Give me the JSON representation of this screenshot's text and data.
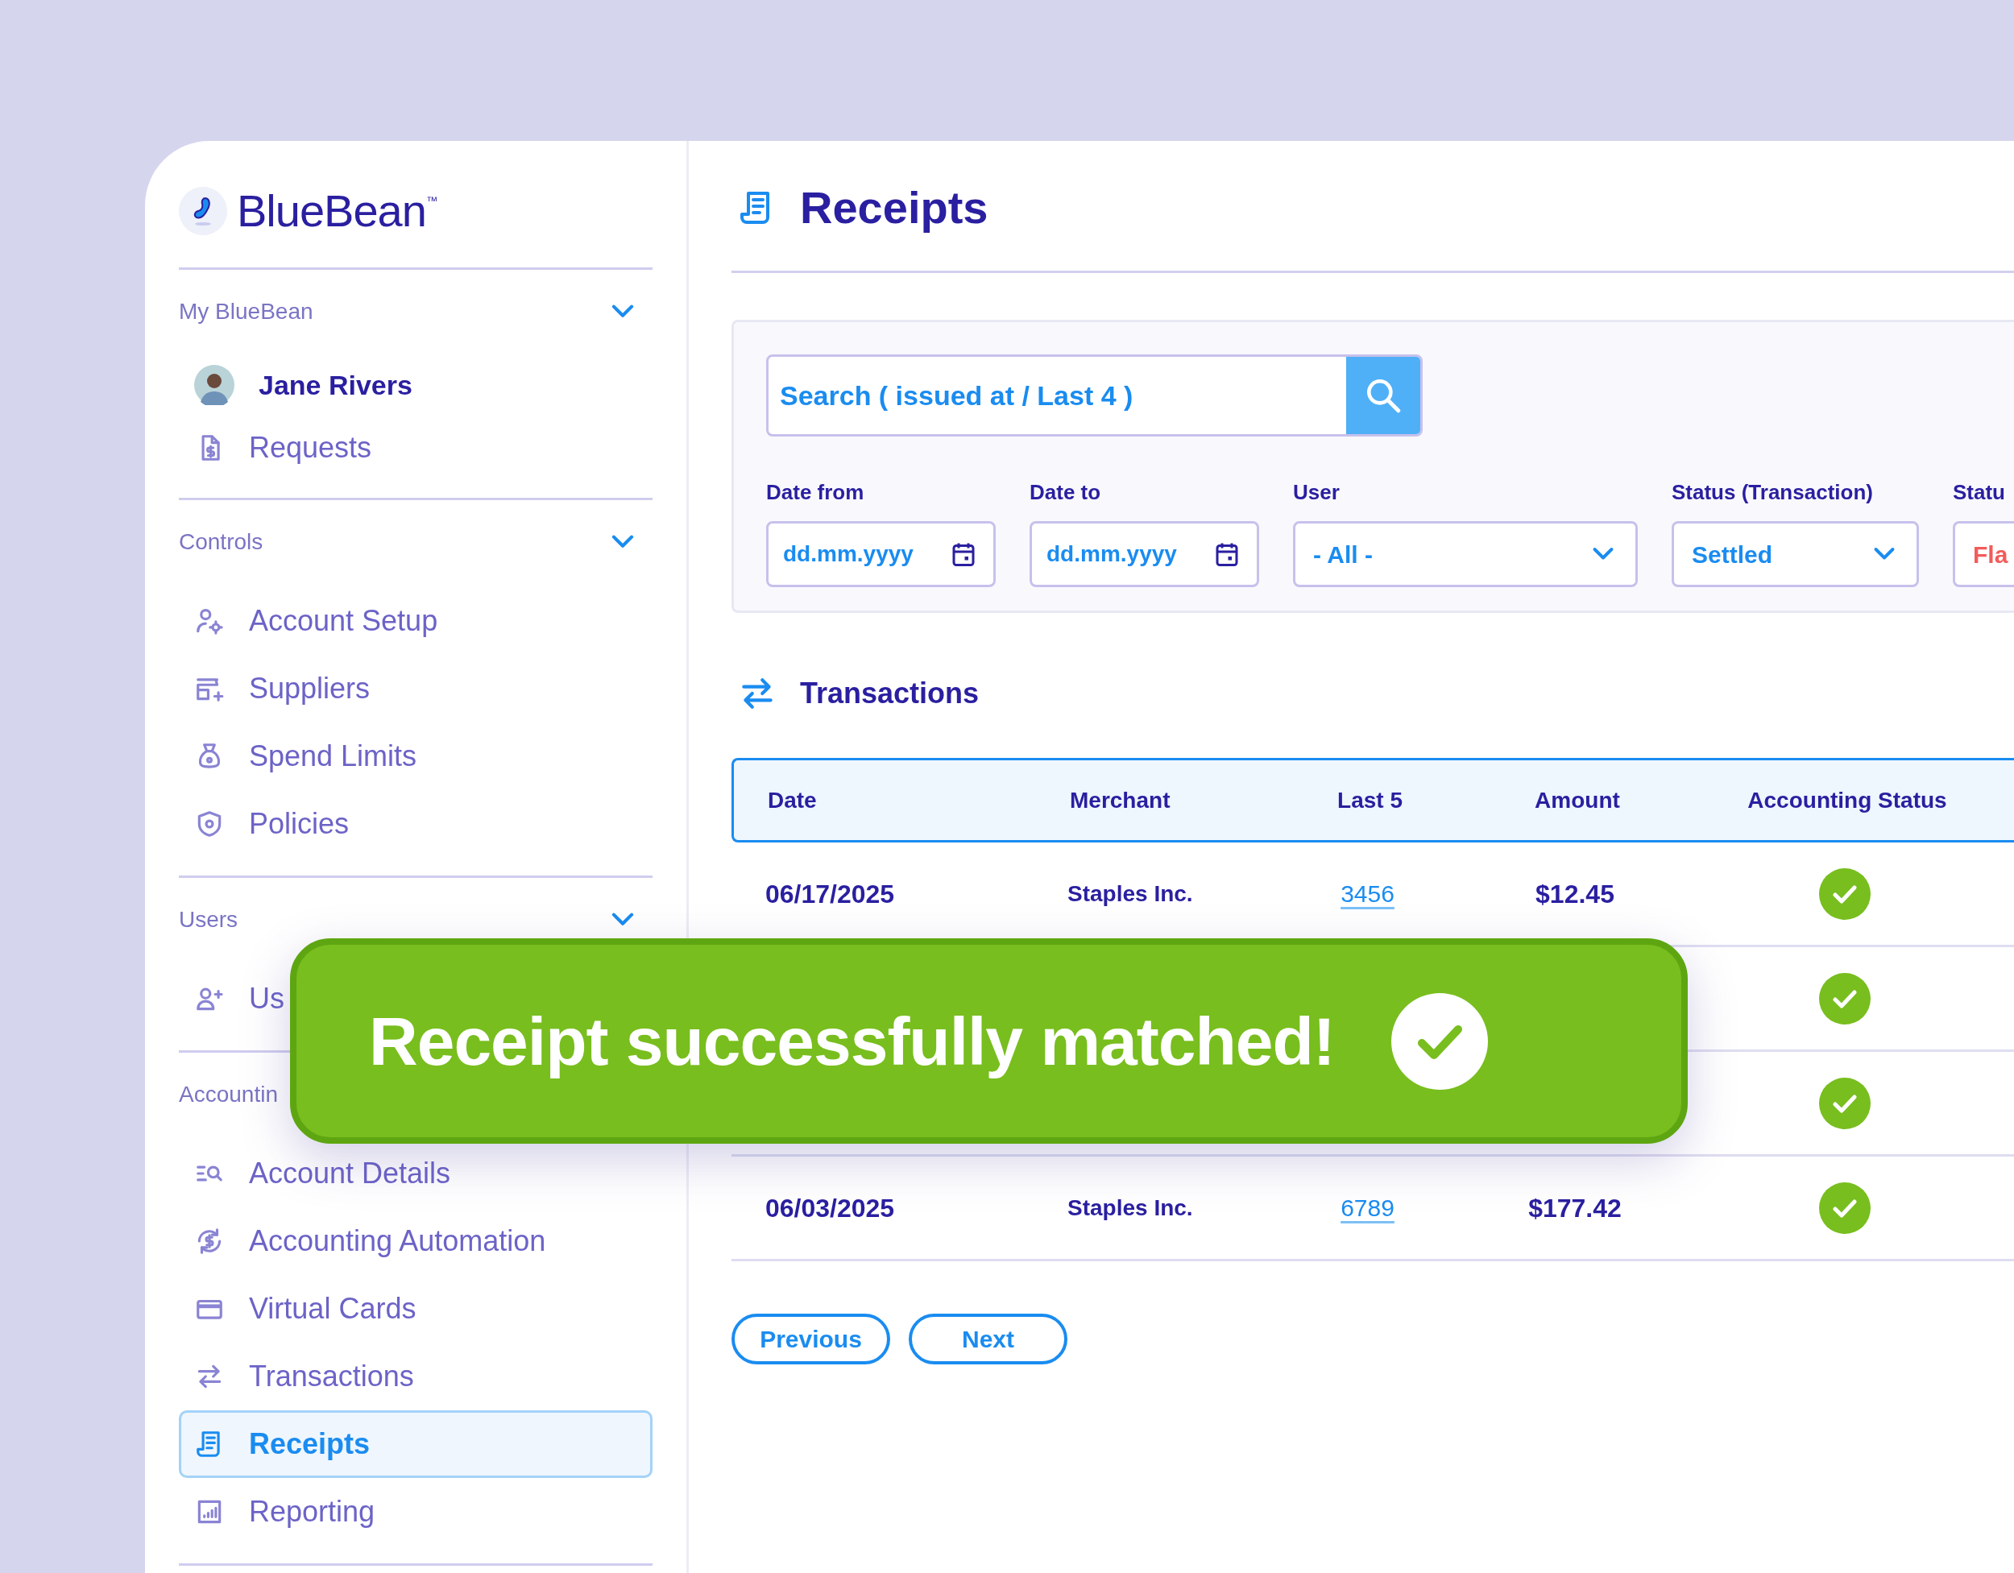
{
  "brand": {
    "name": "BlueBean$^{™}$"
  },
  "sidebar": {
    "sections": [
      {
        "title": "My BlueBean",
        "expanded": true,
        "items": [
          {
            "label": "Jane Rivers",
            "kind": "user",
            "selected": false
          },
          {
            "label": "Requests",
            "kind": "requests",
            "selected": false
          }
        ]
      },
      {
        "title": "Controls",
        "expanded": true,
        "items": [
          {
            "label": "Account Setup",
            "kind": "account-setup",
            "selected": false
          },
          {
            "label": "Suppliers",
            "kind": "suppliers",
            "selected": false
          },
          {
            "label": "Spend Limits",
            "kind": "spend-limits",
            "selected": false
          },
          {
            "label": "Policies",
            "kind": "policies",
            "selected": false
          }
        ]
      },
      {
        "title": "Users",
        "expanded": true,
        "items": [
          {
            "label": "Us",
            "kind": "users",
            "selected": false
          }
        ]
      },
      {
        "title": "Accountin",
        "items": [
          {
            "label": "Account Details",
            "kind": "account-details",
            "selected": false
          },
          {
            "label": "Accounting Automation",
            "kind": "automation",
            "selected": false
          },
          {
            "label": "Virtual Cards",
            "kind": "cards",
            "selected": false
          },
          {
            "label": "Transactions",
            "kind": "transactions",
            "selected": false
          },
          {
            "label": "Receipts",
            "kind": "receipts",
            "selected": true
          },
          {
            "label": "Reporting",
            "kind": "reporting",
            "selected": false
          }
        ]
      }
    ]
  },
  "page": {
    "title": "Receipts"
  },
  "filters": {
    "search": {
      "placeholder": "Search ( issued at / Last 4 )"
    },
    "fields": [
      {
        "label": "Date from",
        "kind": "date",
        "placeholder": "dd.mm.yyyy"
      },
      {
        "label": "Date to",
        "kind": "date",
        "placeholder": "dd.mm.yyyy"
      },
      {
        "label": "User",
        "kind": "select",
        "value": "- All -"
      },
      {
        "label": "Status (Transaction)",
        "kind": "select",
        "value": "Settled"
      },
      {
        "label": "Statu",
        "kind": "partial",
        "value": "Fla"
      }
    ]
  },
  "transactions": {
    "title": "Transactions",
    "columns": [
      "Date",
      "Merchant",
      "Last 5",
      "Amount",
      "Accounting Status"
    ],
    "rows": [
      {
        "date": "06/17/2025",
        "merchant": "Staples Inc.",
        "last5": "3456",
        "amount": "$12.45",
        "matched": true
      },
      {
        "matched": true
      },
      {
        "matched": true
      },
      {
        "date": "06/03/2025",
        "merchant": "Staples Inc.",
        "last5": "6789",
        "amount": "$177.42",
        "matched": true
      }
    ]
  },
  "pagination": [
    "Previous",
    "Next"
  ],
  "toast": {
    "message": "Receipt successfully matched!"
  }
}
